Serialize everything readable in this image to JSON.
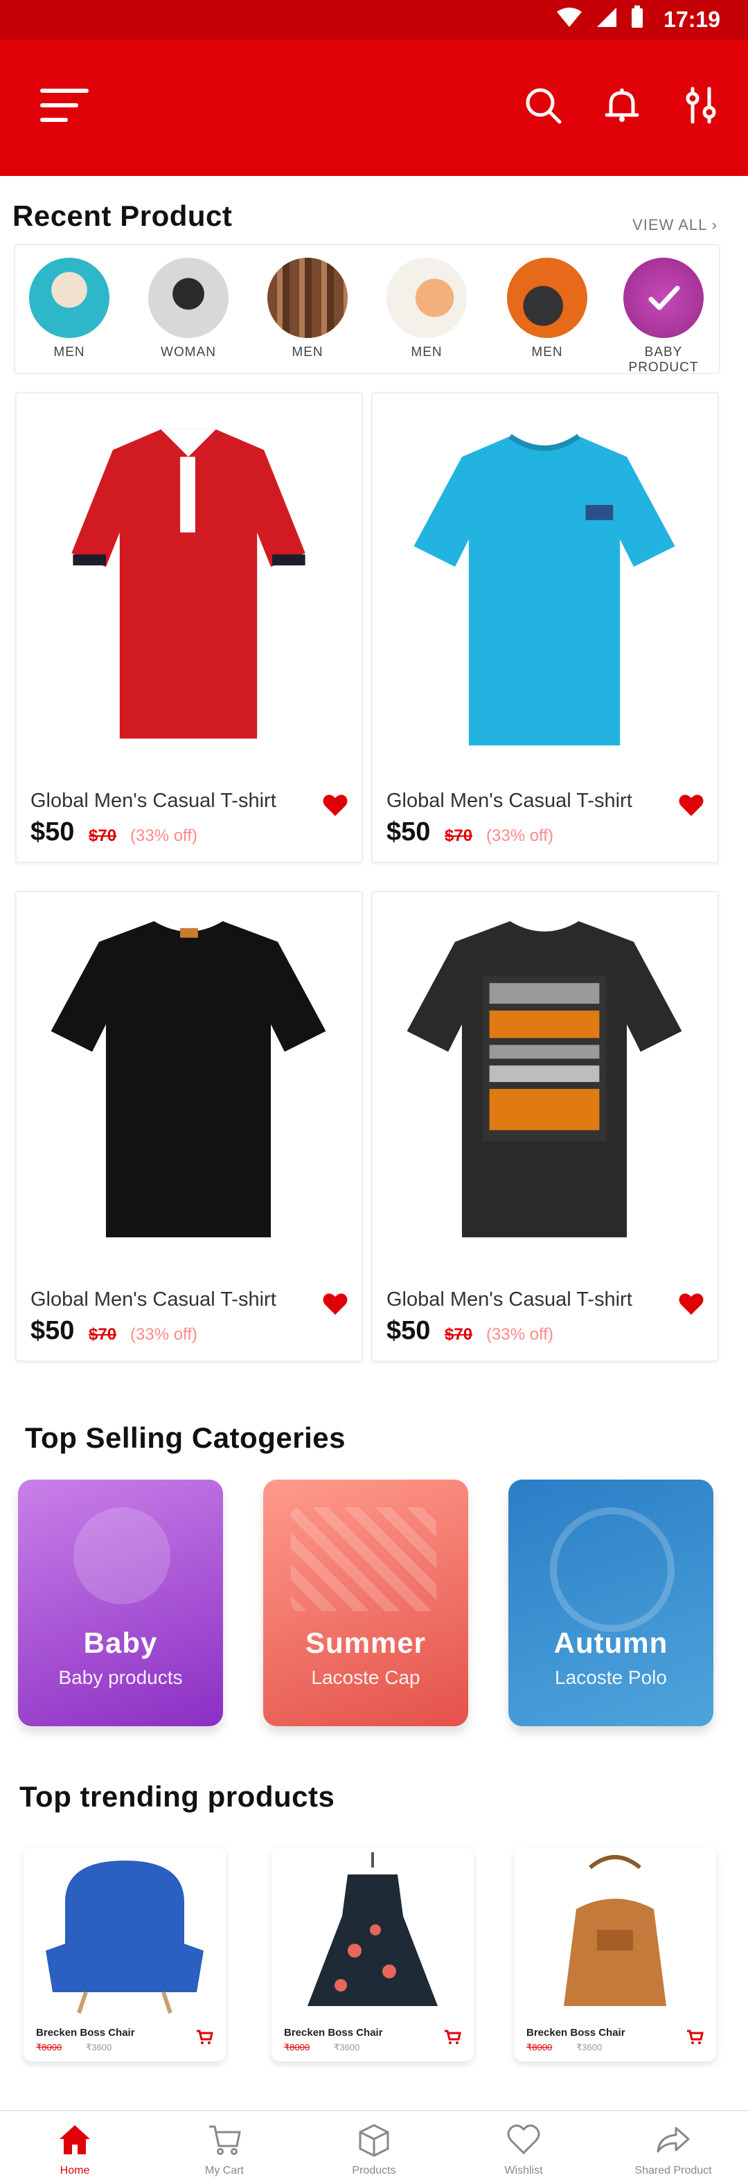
{
  "status": {
    "time": "17:19"
  },
  "header": {
    "menu_icon": "menu-icon",
    "actions": [
      "search-icon",
      "bell-icon",
      "filter-icon"
    ]
  },
  "recent": {
    "title": "Recent Product",
    "view_all": "VIEW ALL",
    "items": [
      {
        "label": "MEN",
        "color": "#2eb7c9"
      },
      {
        "label": "WOMAN",
        "color": "#cfcfcf"
      },
      {
        "label": "MEN",
        "color": "#8b5a3c"
      },
      {
        "label": "MEN",
        "color": "#f2a15f"
      },
      {
        "label": "MEN",
        "color": "#e66a1a"
      },
      {
        "label": "BABY PRODUCT",
        "color": "#b43db0"
      }
    ]
  },
  "products": [
    {
      "name": "Global Men's Casual T-shirt",
      "price": "$50",
      "old": "$70",
      "off": "(33% off)",
      "color": "#d11a22"
    },
    {
      "name": "Global Men's Casual T-shirt",
      "price": "$50",
      "old": "$70",
      "off": "(33% off)",
      "color": "#22b3e0"
    },
    {
      "name": "Global Men's Casual T-shirt",
      "price": "$50",
      "old": "$70",
      "off": "(33% off)",
      "color": "#111111"
    },
    {
      "name": "Global Men's Casual T-shirt",
      "price": "$50",
      "old": "$70",
      "off": "(33% off)",
      "color": "#2a2a2a"
    }
  ],
  "categories_title": "Top Selling Catogeries",
  "categories": [
    {
      "title": "Baby",
      "sub": "Baby products",
      "color1": "#c06be2",
      "color2": "#8b30c4"
    },
    {
      "title": "Summer",
      "sub": "Lacoste Cap",
      "color1": "#ff8a7a",
      "color2": "#e0504a"
    },
    {
      "title": "Autumn",
      "sub": "Lacoste Polo",
      "color1": "#2f86c9",
      "color2": "#4aa0d8"
    }
  ],
  "trending_title": "Top trending products",
  "trending": [
    {
      "name": "Brecken Boss Chair",
      "old": "₹8000",
      "new": "₹3600"
    },
    {
      "name": "Brecken Boss Chair",
      "old": "₹8000",
      "new": "₹3600"
    },
    {
      "name": "Brecken Boss Chair",
      "old": "₹8000",
      "new": "₹3600"
    }
  ],
  "nav": [
    {
      "label": "Home",
      "icon": "home-icon"
    },
    {
      "label": "My Cart",
      "icon": "cart-icon"
    },
    {
      "label": "Products",
      "icon": "box-icon"
    },
    {
      "label": "Wishlist",
      "icon": "heart-icon"
    },
    {
      "label": "Shared Product",
      "icon": "share-icon"
    }
  ],
  "accent": "#e00007"
}
